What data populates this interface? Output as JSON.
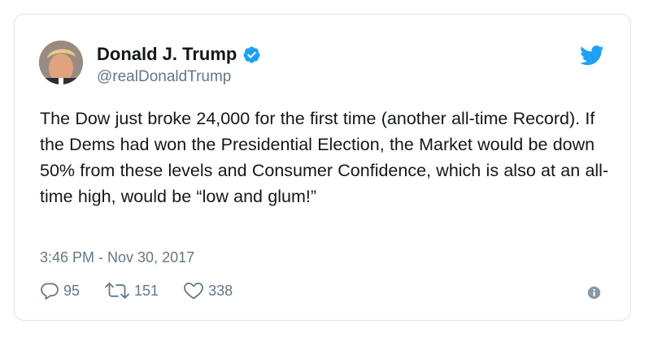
{
  "author": {
    "display_name": "Donald J. Trump",
    "handle": "@realDonaldTrump",
    "verified": true,
    "avatar_icon": "profile-photo"
  },
  "tweet": {
    "text": "The Dow just broke 24,000 for the first time (another all-time Record). If the Dems had won the Presidential Election, the Market would be down 50% from these levels and Consumer Confidence, which is also at an all-time high, would be “low and glum!”",
    "timestamp": "3:46 PM - Nov 30, 2017"
  },
  "stats": {
    "replies": "95",
    "retweets": "151",
    "likes": "338"
  },
  "icons": {
    "brand": "twitter-bird-icon",
    "verified": "verified-badge-icon",
    "reply": "reply-icon",
    "retweet": "retweet-icon",
    "like": "heart-icon",
    "info": "info-icon"
  },
  "colors": {
    "brand_blue": "#1da1f2",
    "text_primary": "#14171a",
    "text_secondary": "#657786",
    "border": "#dfe3e8"
  }
}
